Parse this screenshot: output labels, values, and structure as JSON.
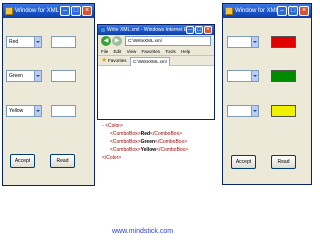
{
  "left_form": {
    "title": "Window for XML",
    "fields": [
      {
        "combo_value": "Red"
      },
      {
        "combo_value": "Green"
      },
      {
        "combo_value": "Yellow"
      }
    ],
    "buttons": {
      "accept": "Accept",
      "read": "Read"
    }
  },
  "browser": {
    "title": "Write XML.xml - Windows Internet Explorer",
    "address": "C:\\WriteXML.xml",
    "menu": [
      "File",
      "Edit",
      "View",
      "Favorites",
      "Tools",
      "Help"
    ],
    "favorites_label": "Favorites",
    "tab_label": "C:\\WriteXML.xml",
    "xml": {
      "root_open": "<Color>",
      "items": [
        {
          "open": "<ComboBox>",
          "value": "Red",
          "close": "</ComboBox>"
        },
        {
          "open": "<ComboBox>",
          "value": "Green",
          "close": "</ComboBox>"
        },
        {
          "open": "<ComboBox>",
          "value": "Yellow",
          "close": "</ComboBox>"
        }
      ],
      "root_close": "</Color>"
    }
  },
  "right_form": {
    "title": "Window for XML",
    "swatch_colors": [
      "#e00000",
      "#008a00",
      "#f0f000"
    ],
    "buttons": {
      "accept": "Accept",
      "read": "Read"
    }
  },
  "footer": {
    "site": "www.mindstick.com"
  }
}
